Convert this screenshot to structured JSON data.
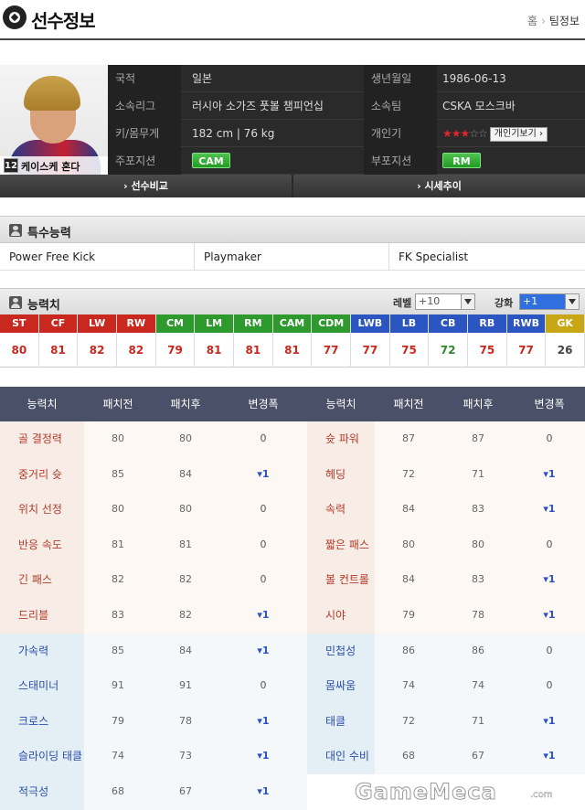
{
  "header": {
    "title": "선수정보",
    "breadcrumb_home": "홈",
    "breadcrumb_current": "팀정보"
  },
  "player": {
    "number": "12",
    "name": "케이스케 혼다",
    "fields": {
      "nationality_label": "국적",
      "nationality": "일본",
      "birth_label": "생년월일",
      "birth": "1986-06-13",
      "league_label": "소속리그",
      "league": "러시아 소가즈 풋볼 챔피언십",
      "team_label": "소속팀",
      "team": "CSKA 모스크바",
      "body_label": "키/몸무게",
      "body": "182 cm  |  76 kg",
      "skill_label": "개인기",
      "skill_stars": "★★★",
      "skill_stars_off": "☆☆",
      "skill_button": "개인기보기",
      "main_pos_label": "주포지션",
      "main_pos": "CAM",
      "sub_pos_label": "부포지션",
      "sub_pos": "RM"
    },
    "compare_button": "› 선수비교",
    "market_button": "› 시세추이"
  },
  "special": {
    "title": "특수능력",
    "skills": [
      "Power Free Kick",
      "Playmaker",
      "FK Specialist"
    ]
  },
  "ability": {
    "title": "능력치",
    "level_label": "레벨",
    "level_value": "+10",
    "enhance_label": "강화",
    "enhance_value": "+1"
  },
  "positions": [
    {
      "pos": "ST",
      "val": "80",
      "color": "#c8281e",
      "vcolor": "#c8281e"
    },
    {
      "pos": "CF",
      "val": "81",
      "color": "#c8281e",
      "vcolor": "#c8281e"
    },
    {
      "pos": "LW",
      "val": "82",
      "color": "#c8281e",
      "vcolor": "#c8281e"
    },
    {
      "pos": "RW",
      "val": "82",
      "color": "#c8281e",
      "vcolor": "#c8281e"
    },
    {
      "pos": "CM",
      "val": "79",
      "color": "#2e9a2e",
      "vcolor": "#c8281e"
    },
    {
      "pos": "LM",
      "val": "81",
      "color": "#2e9a2e",
      "vcolor": "#c8281e"
    },
    {
      "pos": "RM",
      "val": "81",
      "color": "#2e9a2e",
      "vcolor": "#c8281e"
    },
    {
      "pos": "CAM",
      "val": "81",
      "color": "#2e9a2e",
      "vcolor": "#c8281e"
    },
    {
      "pos": "CDM",
      "val": "77",
      "color": "#2e9a2e",
      "vcolor": "#c8281e"
    },
    {
      "pos": "LWB",
      "val": "77",
      "color": "#2b55c0",
      "vcolor": "#c8281e"
    },
    {
      "pos": "LB",
      "val": "75",
      "color": "#2b55c0",
      "vcolor": "#c8281e"
    },
    {
      "pos": "CB",
      "val": "72",
      "color": "#2b55c0",
      "vcolor": "#2e8a2e"
    },
    {
      "pos": "RB",
      "val": "75",
      "color": "#2b55c0",
      "vcolor": "#c8281e"
    },
    {
      "pos": "RWB",
      "val": "77",
      "color": "#2b55c0",
      "vcolor": "#c8281e"
    },
    {
      "pos": "GK",
      "val": "26",
      "color": "#c8a614",
      "vcolor": "#444444"
    }
  ],
  "stat_table": {
    "headers": [
      "능력치",
      "패치전",
      "패치후",
      "변경폭",
      "능력치",
      "패치전",
      "패치후",
      "변경폭"
    ],
    "rows": [
      {
        "l": [
          "골 결정력",
          "80",
          "80",
          "0"
        ],
        "r": [
          "슛 파워",
          "87",
          "87",
          "0"
        ],
        "tone": "warm"
      },
      {
        "l": [
          "중거리 슛",
          "85",
          "84",
          "▾1"
        ],
        "r": [
          "헤딩",
          "72",
          "71",
          "▾1"
        ],
        "tone": "warm"
      },
      {
        "l": [
          "위치 선정",
          "80",
          "80",
          "0"
        ],
        "r": [
          "속력",
          "84",
          "83",
          "▾1"
        ],
        "tone": "warm"
      },
      {
        "l": [
          "반응 속도",
          "81",
          "81",
          "0"
        ],
        "r": [
          "짧은 패스",
          "80",
          "80",
          "0"
        ],
        "tone": "warm"
      },
      {
        "l": [
          "긴 패스",
          "82",
          "82",
          "0"
        ],
        "r": [
          "볼 컨트롤",
          "84",
          "83",
          "▾1"
        ],
        "tone": "warm"
      },
      {
        "l": [
          "드리블",
          "83",
          "82",
          "▾1"
        ],
        "r": [
          "시야",
          "79",
          "78",
          "▾1"
        ],
        "tone": "warm"
      },
      {
        "l": [
          "가속력",
          "85",
          "84",
          "▾1"
        ],
        "r": [
          "민첩성",
          "86",
          "86",
          "0"
        ],
        "tone": "cool"
      },
      {
        "l": [
          "스태미너",
          "91",
          "91",
          "0"
        ],
        "r": [
          "몸싸움",
          "74",
          "74",
          "0"
        ],
        "tone": "cool"
      },
      {
        "l": [
          "크로스",
          "79",
          "78",
          "▾1"
        ],
        "r": [
          "태클",
          "72",
          "71",
          "▾1"
        ],
        "tone": "cool"
      },
      {
        "l": [
          "슬라이딩 태클",
          "74",
          "73",
          "▾1"
        ],
        "r": [
          "대인 수비",
          "68",
          "67",
          "▾1"
        ],
        "tone": "cool"
      },
      {
        "l": [
          "적극성",
          "68",
          "67",
          "▾1"
        ],
        "r": [
          "",
          "",
          "",
          ""
        ],
        "tone": "cool"
      }
    ]
  },
  "watermark": {
    "main": "GameMeca",
    "suffix": ".com"
  },
  "colors": {
    "warm_name_bg": "#f7ede6",
    "warm_val_bg": "#fdf8f4",
    "cool_name_bg": "#e4eef5",
    "cool_val_bg": "#f4f8fb",
    "minus": "#2a52c8",
    "header_bg": "#4a5068"
  }
}
